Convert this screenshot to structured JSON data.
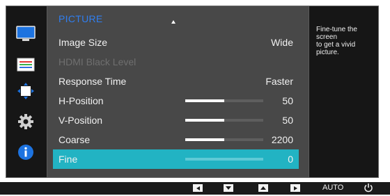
{
  "menu": {
    "title": "PICTURE",
    "items": [
      {
        "label": "Image Size",
        "value": "Wide",
        "disabled": false,
        "selected": false
      },
      {
        "label": "HDMI Black Level",
        "value": "",
        "disabled": true,
        "selected": false
      },
      {
        "label": "Response Time",
        "value": "Faster",
        "disabled": false,
        "selected": false
      },
      {
        "label": "H-Position",
        "value": "50",
        "level": 0.5,
        "disabled": false,
        "selected": false
      },
      {
        "label": "V-Position",
        "value": "50",
        "level": 0.5,
        "disabled": false,
        "selected": false
      },
      {
        "label": "Coarse",
        "value": "2200",
        "level": 0.5,
        "disabled": false,
        "selected": false
      },
      {
        "label": "Fine",
        "value": "0",
        "level": 0.0,
        "disabled": false,
        "selected": true
      }
    ]
  },
  "help": {
    "lines": [
      "Fine-tune the",
      "screen",
      "to get a vivid",
      "picture."
    ]
  },
  "sidebar": {
    "icons": [
      "monitor-icon",
      "color-adjust-icon",
      "size-position-icon",
      "settings-gear-icon",
      "info-icon"
    ]
  },
  "bottom_bar": {
    "keys": [
      "left-arrow-key",
      "down-arrow-key",
      "up-arrow-key",
      "right-arrow-key"
    ],
    "auto_label": "AUTO",
    "power_icon": "power-icon"
  },
  "colors": {
    "accent": "#22b3c3",
    "title": "#2f7ef0",
    "background": "#161616",
    "panel": "#484848"
  }
}
